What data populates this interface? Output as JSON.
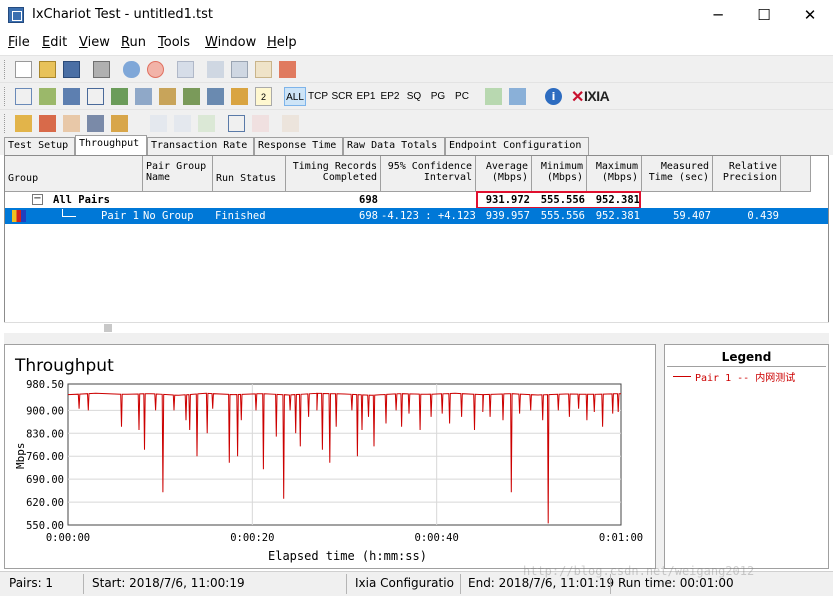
{
  "window": {
    "title": "IxChariot Test - untitled1.tst",
    "minimize": "─",
    "maximize": "☐",
    "close": "✕"
  },
  "menu": [
    {
      "key": "F",
      "rest": "ile"
    },
    {
      "key": "E",
      "rest": "dit"
    },
    {
      "key": "V",
      "rest": "iew"
    },
    {
      "key": "R",
      "rest": "un"
    },
    {
      "key": "T",
      "rest": "ools"
    },
    {
      "key": "W",
      "rest": "indow"
    },
    {
      "key": "H",
      "rest": "elp"
    }
  ],
  "toolbar2": {
    "filters": [
      "ALL",
      "TCP",
      "SCR",
      "EP1",
      "EP2",
      "SQ",
      "PG",
      "PC"
    ],
    "logo": "IXIA",
    "badge": "2"
  },
  "tabs": [
    "Test Setup",
    "Throughput",
    "Transaction Rate",
    "Response Time",
    "Raw Data Totals",
    "Endpoint Configuration"
  ],
  "active_tab": "Throughput",
  "table": {
    "headers": {
      "group": "Group",
      "pair_group": "Pair Group\nName",
      "run_status": "Run Status",
      "timing": "Timing Records\n     Completed",
      "confidence": "95% Confidence\n      Interval",
      "average": "Average\n (Mbps)",
      "minimum": "Minimum\n (Mbps)",
      "maximum": "Maximum\n (Mbps)",
      "measured": "Measured\nTime (sec)",
      "relative": "Relative\nPrecision"
    },
    "all_pairs": {
      "expander": "−",
      "label": "All Pairs",
      "records": "698",
      "average": "931.972",
      "minimum": "555.556",
      "maximum": "952.381"
    },
    "pair1": {
      "label": "Pair 1",
      "group": "No Group",
      "status": "Finished",
      "records": "698",
      "confidence": "-4.123 : +4.123",
      "average": "939.957",
      "minimum": "555.556",
      "maximum": "952.381",
      "measured": "59.407",
      "relative": "0.439"
    }
  },
  "chart_data": {
    "type": "line",
    "title": "Throughput",
    "xlabel": "Elapsed time (h:mm:ss)",
    "ylabel": "Mbps",
    "yticks": [
      "980.50",
      "900.00",
      "830.00",
      "760.00",
      "690.00",
      "620.00",
      "550.00"
    ],
    "ytick_values": [
      980.5,
      900,
      830,
      760,
      690,
      620,
      550
    ],
    "xticks": [
      "0:00:00",
      "0:00:20",
      "0:00:40",
      "0:01:00"
    ],
    "xlim": [
      0,
      60
    ],
    "ylim": [
      550,
      980.5
    ],
    "grid": true,
    "line_color": "#cc0000",
    "series": [
      {
        "name": "Pair 1 -- 内网测试",
        "base": [
          [
            0,
            948
          ],
          [
            3,
            952
          ],
          [
            6,
            949
          ],
          [
            9,
            951
          ],
          [
            12,
            946
          ],
          [
            15,
            952
          ],
          [
            18,
            948
          ],
          [
            21,
            951
          ],
          [
            24,
            947
          ],
          [
            27,
            952
          ],
          [
            30,
            950
          ],
          [
            33,
            946
          ],
          [
            36,
            951
          ],
          [
            39,
            949
          ],
          [
            42,
            952
          ],
          [
            45,
            948
          ],
          [
            48,
            951
          ],
          [
            51,
            947
          ],
          [
            54,
            950
          ],
          [
            57,
            949
          ],
          [
            60,
            951
          ]
        ],
        "dips": [
          [
            1.2,
            905
          ],
          [
            2.2,
            900
          ],
          [
            5.8,
            850
          ],
          [
            7.7,
            840
          ],
          [
            8.3,
            780
          ],
          [
            9.5,
            900
          ],
          [
            10.3,
            650
          ],
          [
            11.5,
            900
          ],
          [
            12.8,
            870
          ],
          [
            13.2,
            840
          ],
          [
            14.0,
            760
          ],
          [
            15.1,
            830
          ],
          [
            15.7,
            905
          ],
          [
            17.5,
            740
          ],
          [
            18.4,
            760
          ],
          [
            18.8,
            870
          ],
          [
            20.4,
            900
          ],
          [
            21.2,
            720
          ],
          [
            22.6,
            820
          ],
          [
            23.4,
            630
          ],
          [
            24.1,
            900
          ],
          [
            24.7,
            830
          ],
          [
            25.2,
            790
          ],
          [
            26.1,
            880
          ],
          [
            27.0,
            900
          ],
          [
            27.6,
            780
          ],
          [
            28.4,
            740
          ],
          [
            29.1,
            850
          ],
          [
            30.8,
            900
          ],
          [
            31.4,
            760
          ],
          [
            31.9,
            840
          ],
          [
            32.6,
            880
          ],
          [
            33.2,
            790
          ],
          [
            34.5,
            860
          ],
          [
            35.6,
            900
          ],
          [
            36.2,
            850
          ],
          [
            37.0,
            890
          ],
          [
            38.2,
            840
          ],
          [
            39.4,
            880
          ],
          [
            40.6,
            890
          ],
          [
            41.4,
            860
          ],
          [
            42.7,
            880
          ],
          [
            44.1,
            840
          ],
          [
            45.0,
            895
          ],
          [
            45.8,
            880
          ],
          [
            47.2,
            870
          ],
          [
            48.1,
            650
          ],
          [
            49.0,
            890
          ],
          [
            50.2,
            900
          ],
          [
            51.5,
            870
          ],
          [
            52.1,
            555
          ],
          [
            53.2,
            900
          ],
          [
            54.4,
            880
          ],
          [
            55.4,
            905
          ],
          [
            56.3,
            870
          ],
          [
            57.1,
            895
          ],
          [
            58.0,
            850
          ],
          [
            59.1,
            890
          ],
          [
            59.7,
            895
          ]
        ]
      }
    ]
  },
  "legend": {
    "title": "Legend",
    "entry": "Pair 1 -- 内网测试"
  },
  "watermark": "http://blog.csdn.net/weigang2012",
  "status": {
    "pairs": "Pairs: 1",
    "start": "Start: 2018/7/6, 11:00:19",
    "config": "Ixia Configuratio",
    "end": "End: 2018/7/6, 11:01:19",
    "runtime": "Run time: 00:01:00"
  }
}
